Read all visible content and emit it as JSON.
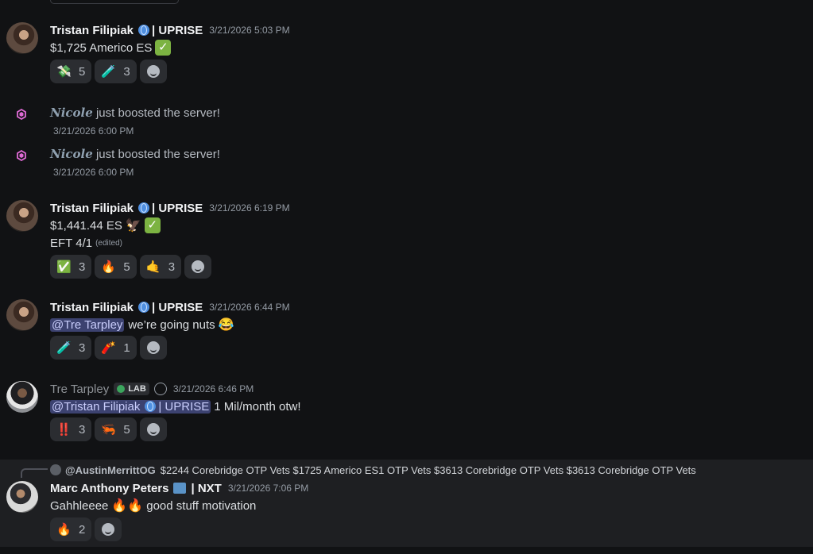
{
  "messages": [
    {
      "author": "Tristan Filipiak",
      "tag": "| UPRISE",
      "time": "3/21/2026 5:03 PM",
      "text": "$1,725 Americo ES",
      "reactions": [
        {
          "icon": "money-wings-icon",
          "glyph": "💸",
          "count": "5"
        },
        {
          "icon": "flask-icon",
          "glyph": "🧪",
          "count": "3"
        }
      ]
    },
    {
      "author": "Tristan Filipiak",
      "tag": "| UPRISE",
      "time": "3/21/2026 6:19 PM",
      "text": "$1,441.44 ES",
      "text2": "EFT 4/1",
      "edited": "(edited)",
      "reactions": [
        {
          "icon": "check-icon",
          "glyph": "✅",
          "count": "3"
        },
        {
          "icon": "fire-icon",
          "glyph": "🔥",
          "count": "5"
        },
        {
          "icon": "call-me-hand-icon",
          "glyph": "🤙",
          "count": "3"
        }
      ]
    },
    {
      "author": "Tristan Filipiak",
      "tag": "| UPRISE",
      "time": "3/21/2026 6:44 PM",
      "mention": "@Tre Tarpley",
      "text": "we’re going nuts",
      "reactions": [
        {
          "icon": "flask-icon",
          "glyph": "🧪",
          "count": "3"
        },
        {
          "icon": "firecracker-icon",
          "glyph": "🧨",
          "count": "1"
        }
      ]
    },
    {
      "author": "Tre Tarpley",
      "badge": "LAB",
      "time": "3/21/2026 6:46 PM",
      "mention": "@Tristan Filipiak",
      "mention_tag": "| UPRISE",
      "text": "1 Mil/month otw!",
      "reactions": [
        {
          "icon": "double-exclamation-icon",
          "glyph": "‼️",
          "count": "3"
        },
        {
          "icon": "shrimp-icon",
          "glyph": "🦐",
          "count": "5"
        }
      ]
    },
    {
      "reply_name": "@AustinMerrittOG",
      "reply_text": "$2244  Corebridge  OTP Vets  $1725 Americo ES1 OTP Vets  $3613 Corebridge  OTP Vets  $3613 Corebridge OTP Vets",
      "author": "Marc Anthony Peters",
      "tag": "| NXT",
      "time": "3/21/2026 7:06 PM",
      "text": "Gahhleeee",
      "text_after": "good stuff motivation",
      "reactions": [
        {
          "icon": "fire-icon",
          "glyph": "🔥",
          "count": "2"
        }
      ]
    }
  ],
  "boosts": [
    {
      "name": "Nicole",
      "text": "just boosted the server!",
      "time": "3/21/2026 6:00 PM"
    },
    {
      "name": "Nicole",
      "text": "just boosted the server!",
      "time": "3/21/2026 6:00 PM"
    }
  ],
  "colors": {
    "background": "#111214",
    "highlight": "#1e1f22",
    "mention_bg": "#3c4270",
    "boost_pink": "#e06bd6"
  }
}
